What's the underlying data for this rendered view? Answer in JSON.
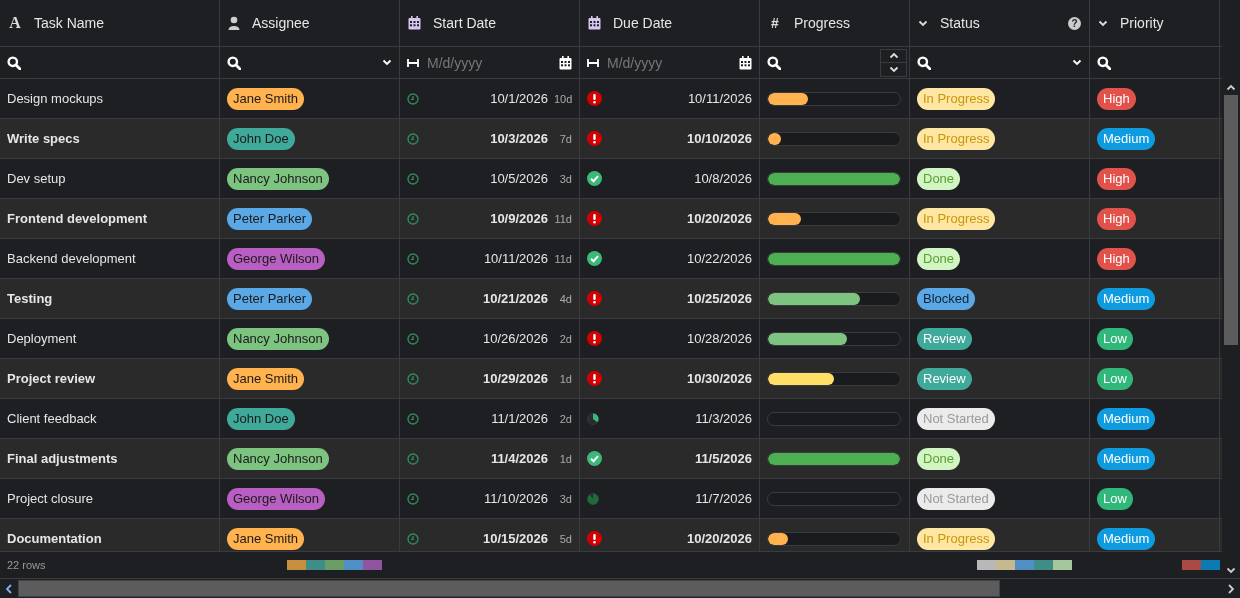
{
  "columns": [
    {
      "label": "Task Name",
      "kind": "glyph",
      "icon": "A"
    },
    {
      "label": "Assignee",
      "kind": "person",
      "summary": [
        {
          "color": "#c68f3e"
        },
        {
          "color": "#3e8d87"
        },
        {
          "color": "#6a9e66"
        },
        {
          "color": "#4f8fc4"
        },
        {
          "color": "#9155a0"
        }
      ]
    },
    {
      "label": "Start Date",
      "kind": "calendar"
    },
    {
      "label": "Due Date",
      "kind": "calendar"
    },
    {
      "label": "Progress",
      "kind": "glyph",
      "icon": "#"
    },
    {
      "label": "Status",
      "kind": "chevron",
      "help": "?",
      "summary": [
        {
          "color": "#b8b8b8"
        },
        {
          "color": "#c6b990"
        },
        {
          "color": "#4f8fc4"
        },
        {
          "color": "#3e8d87"
        },
        {
          "color": "#a6c79e"
        }
      ]
    },
    {
      "label": "Priority",
      "kind": "chevron",
      "summary": [
        {
          "color": "#a94a45"
        },
        {
          "color": "#0c7bb3"
        }
      ]
    }
  ],
  "filters": [
    {
      "kind": "search"
    },
    {
      "kind": "search_select"
    },
    {
      "kind": "date_range",
      "placeholder": "M/d/yyyy"
    },
    {
      "kind": "date_range",
      "placeholder": "M/d/yyyy"
    },
    {
      "kind": "number"
    },
    {
      "kind": "search_select"
    },
    {
      "kind": "search"
    }
  ],
  "rows": [
    {
      "task": "Design mockups",
      "assignee": {
        "name": "Jane Smith",
        "color": "#ffb24d"
      },
      "start": "10/1/2026",
      "duration": "10d",
      "due": {
        "kind": "overdue",
        "date": "10/11/2026"
      },
      "progress": {
        "level": 0.3
      },
      "status": {
        "label": "In Progress",
        "kind": "in_progress"
      },
      "priority": {
        "label": "High",
        "color": "#e0524a"
      }
    },
    {
      "task": "Write specs",
      "assignee": {
        "name": "John Doe",
        "color": "#3fa99a"
      },
      "start": "10/3/2026",
      "duration": "7d",
      "due": {
        "kind": "overdue",
        "date": "10/10/2026"
      },
      "progress": {
        "level": 0.1
      },
      "status": {
        "label": "In Progress",
        "kind": "in_progress"
      },
      "priority": {
        "label": "Medium",
        "color": "#0e9be0"
      }
    },
    {
      "task": "Dev setup",
      "assignee": {
        "name": "Nancy Johnson",
        "color": "#7cc47f"
      },
      "start": "10/5/2026",
      "duration": "3d",
      "due": {
        "kind": "done",
        "date": "10/8/2026"
      },
      "progress": {
        "level": 1
      },
      "status": {
        "label": "Done",
        "kind": "done"
      },
      "priority": {
        "label": "High",
        "color": "#e0524a"
      }
    },
    {
      "task": "Frontend development",
      "assignee": {
        "name": "Peter Parker",
        "color": "#5aa9e6"
      },
      "start": "10/9/2026",
      "duration": "11d",
      "due": {
        "kind": "overdue",
        "date": "10/20/2026"
      },
      "progress": {
        "level": 0.25
      },
      "status": {
        "label": "In Progress",
        "kind": "in_progress"
      },
      "priority": {
        "label": "High",
        "color": "#e0524a"
      }
    },
    {
      "task": "Backend development",
      "assignee": {
        "name": "George Wilson",
        "color": "#b95fc4"
      },
      "start": "10/11/2026",
      "duration": "11d",
      "due": {
        "kind": "done",
        "date": "10/22/2026"
      },
      "progress": {
        "level": 1
      },
      "status": {
        "label": "Done",
        "kind": "done"
      },
      "priority": {
        "label": "High",
        "color": "#e0524a"
      }
    },
    {
      "task": "Testing",
      "assignee": {
        "name": "Peter Parker",
        "color": "#5aa9e6"
      },
      "start": "10/21/2026",
      "duration": "4d",
      "due": {
        "kind": "overdue",
        "date": "10/25/2026"
      },
      "progress": {
        "level": 0.7
      },
      "status": {
        "label": "Blocked",
        "kind": "blocked"
      },
      "priority": {
        "label": "Medium",
        "color": "#0e9be0"
      }
    },
    {
      "task": "Deployment",
      "assignee": {
        "name": "Nancy Johnson",
        "color": "#7cc47f"
      },
      "start": "10/26/2026",
      "duration": "2d",
      "due": {
        "kind": "overdue",
        "date": "10/28/2026"
      },
      "progress": {
        "level": 0.6
      },
      "status": {
        "label": "Review",
        "kind": "review"
      },
      "priority": {
        "label": "Low",
        "color": "#2fb87a"
      }
    },
    {
      "task": "Project review",
      "assignee": {
        "name": "Jane Smith",
        "color": "#ffb24d"
      },
      "start": "10/29/2026",
      "duration": "1d",
      "due": {
        "kind": "overdue",
        "date": "10/30/2026"
      },
      "progress": {
        "level": 0.5
      },
      "status": {
        "label": "Review",
        "kind": "review"
      },
      "priority": {
        "label": "Low",
        "color": "#2fb87a"
      }
    },
    {
      "task": "Client feedback",
      "assignee": {
        "name": "John Doe",
        "color": "#3fa99a"
      },
      "start": "11/1/2026",
      "duration": "2d",
      "due": {
        "kind": "pending_early",
        "date": "11/3/2026"
      },
      "progress": {
        "level": 0
      },
      "status": {
        "label": "Not Started",
        "kind": "not_started"
      },
      "priority": {
        "label": "Medium",
        "color": "#0e9be0"
      }
    },
    {
      "task": "Final adjustments",
      "assignee": {
        "name": "Nancy Johnson",
        "color": "#7cc47f"
      },
      "start": "11/4/2026",
      "duration": "1d",
      "due": {
        "kind": "done",
        "date": "11/5/2026"
      },
      "progress": {
        "level": 1
      },
      "status": {
        "label": "Done",
        "kind": "done"
      },
      "priority": {
        "label": "Medium",
        "color": "#0e9be0"
      }
    },
    {
      "task": "Project closure",
      "assignee": {
        "name": "George Wilson",
        "color": "#b95fc4"
      },
      "start": "11/10/2026",
      "duration": "3d",
      "due": {
        "kind": "pending_late",
        "date": "11/7/2026"
      },
      "progress": {
        "level": 0
      },
      "status": {
        "label": "Not Started",
        "kind": "not_started"
      },
      "priority": {
        "label": "Low",
        "color": "#2fb87a"
      }
    },
    {
      "task": "Documentation",
      "assignee": {
        "name": "Jane Smith",
        "color": "#ffb24d"
      },
      "start": "10/15/2026",
      "duration": "5d",
      "due": {
        "kind": "overdue",
        "date": "10/20/2026"
      },
      "progress": {
        "level": 0.15
      },
      "status": {
        "label": "In Progress",
        "kind": "in_progress"
      },
      "priority": {
        "label": "Medium",
        "color": "#0e9be0"
      }
    }
  ],
  "footer": {
    "row_count": "22 rows"
  }
}
